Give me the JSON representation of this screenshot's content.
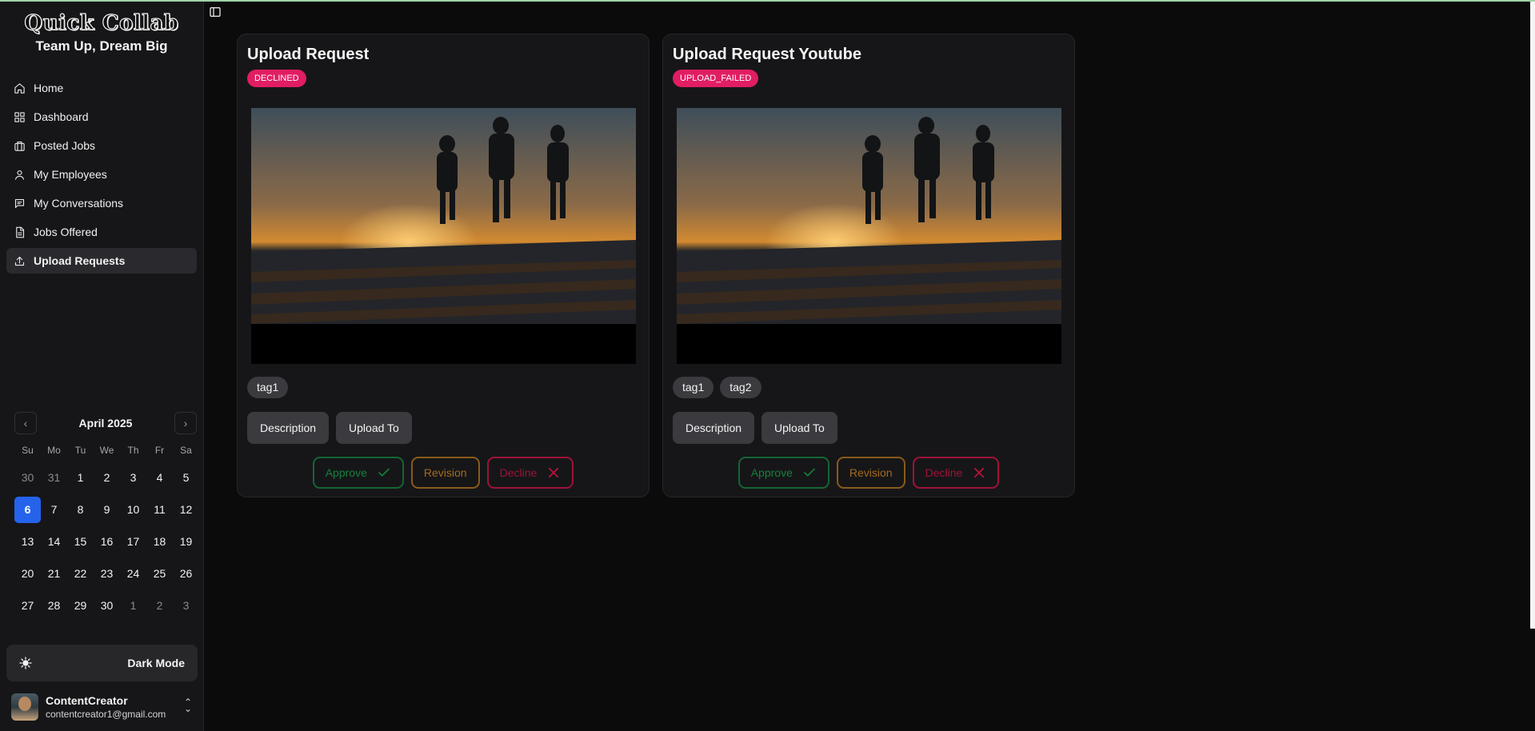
{
  "brand": {
    "title": "Quick Collab",
    "subtitle": "Team Up, Dream Big"
  },
  "nav": [
    {
      "label": "Home",
      "icon": "home-icon"
    },
    {
      "label": "Dashboard",
      "icon": "dashboard-icon"
    },
    {
      "label": "Posted Jobs",
      "icon": "briefcase-icon"
    },
    {
      "label": "My Employees",
      "icon": "user-icon"
    },
    {
      "label": "My Conversations",
      "icon": "message-icon"
    },
    {
      "label": "Jobs Offered",
      "icon": "document-icon"
    },
    {
      "label": "Upload Requests",
      "icon": "upload-icon",
      "active": true
    }
  ],
  "calendar": {
    "month": "April 2025",
    "weekdays": [
      "Su",
      "Mo",
      "Tu",
      "We",
      "Th",
      "Fr",
      "Sa"
    ],
    "days": [
      [
        "30",
        "31",
        "1",
        "2",
        "3",
        "4",
        "5"
      ],
      [
        "6",
        "7",
        "8",
        "9",
        "10",
        "11",
        "12"
      ],
      [
        "13",
        "14",
        "15",
        "16",
        "17",
        "18",
        "19"
      ],
      [
        "20",
        "21",
        "22",
        "23",
        "24",
        "25",
        "26"
      ],
      [
        "27",
        "28",
        "29",
        "30",
        "1",
        "2",
        "3"
      ]
    ],
    "selected": "6"
  },
  "theme": {
    "label": "Dark Mode"
  },
  "user": {
    "name": "ContentCreator",
    "email": "contentcreator1@gmail.com"
  },
  "cards": [
    {
      "title": "Upload Request",
      "status": "DECLINED",
      "tags": [
        "tag1"
      ],
      "actions": {
        "description": "Description",
        "upload_to": "Upload To"
      },
      "decisions": {
        "approve": "Approve",
        "revision": "Revision",
        "decline": "Decline"
      }
    },
    {
      "title": "Upload Request Youtube",
      "status": "UPLOAD_FAILED",
      "tags": [
        "tag1",
        "tag2"
      ],
      "actions": {
        "description": "Description",
        "upload_to": "Upload To"
      },
      "decisions": {
        "approve": "Approve",
        "revision": "Revision",
        "decline": "Decline"
      }
    }
  ],
  "colors": {
    "status_badge": "#e11d63",
    "selected_day": "#2563eb",
    "approve": "#15803d",
    "revision": "#a36a1f",
    "decline": "#9f1239"
  }
}
